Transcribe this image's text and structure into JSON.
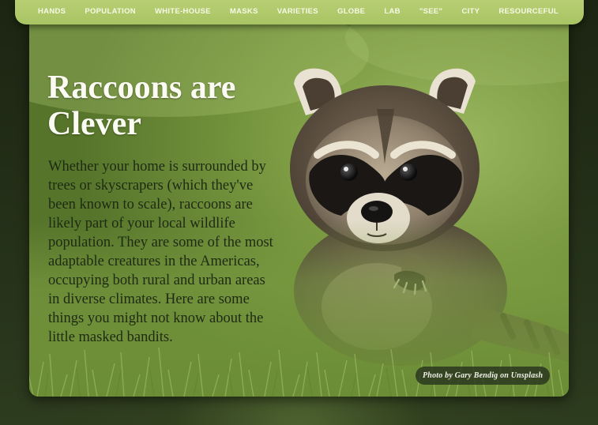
{
  "nav": {
    "items": [
      "HANDS",
      "POPULATION",
      "WHITE-HOUSE",
      "MASKS",
      "VARIETIES",
      "GLOBE",
      "LAB",
      "\"SEE\"",
      "CITY",
      "RESOURCEFUL"
    ]
  },
  "hero": {
    "title": "Raccoons are Clever",
    "body": "Whether your home is surrounded by trees or skyscrapers (which they've been known to scale), raccoons are likely part of your local wildlife population. They are some of the most adaptable creatures in the Americas, occupying both rural and urban areas in diverse climates. Here are some things you might not know about the little masked bandits.",
    "photo_credit": "Photo by Gary Bendig on Unsplash",
    "image_subject": "raccoon-photo"
  },
  "colors": {
    "nav_bg": "#b0c96b",
    "nav_text": "#f6f9e6",
    "page_bg": "#1f2a16",
    "title_text": "#fbfbf4",
    "body_text": "#1e2a14"
  }
}
